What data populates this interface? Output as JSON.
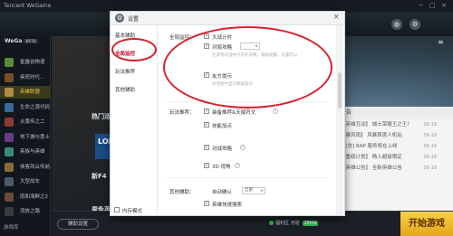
{
  "app": {
    "title": "Tencent WeGame",
    "brand": "WeGa",
    "brand_badge": "BETA",
    "nav_icons": [
      "home-icon",
      "shield-icon",
      "store-icon"
    ],
    "window_controls": [
      "−",
      "□",
      "×"
    ]
  },
  "sidebar": {
    "items": [
      {
        "label": "星露谷物语",
        "color": "#5c8a3a"
      },
      {
        "label": "疾死时代…",
        "color": "#7a4b2a"
      },
      {
        "label": "英雄联盟",
        "color": "#b08a43",
        "active": true
      },
      {
        "label": "生命之源代码",
        "color": "#3b6a9a"
      },
      {
        "label": "炎黄传之二",
        "color": "#8a3a3a"
      },
      {
        "label": "地下城与勇士",
        "color": "#6a3a8a"
      },
      {
        "label": "英族与英雄",
        "color": "#3a8a7a"
      },
      {
        "label": "侠客风云传前…",
        "color": "#8a6a3a"
      },
      {
        "label": "大型战车",
        "color": "#4a5a6a"
      },
      {
        "label": "雨和海鲜之2",
        "color": "#6a4a3a"
      },
      {
        "label": "流放之路",
        "color": "#3a3a3a"
      }
    ],
    "footer": "游戏库"
  },
  "hero": {
    "section_hot": "热门活",
    "promo_text": "LOL7",
    "section_new": "新F4",
    "section_cover": "周免英",
    "news_tab": "公告",
    "news": [
      {
        "title": "【英雄互动】 城士荣耀王之王！",
        "date": "09-16"
      },
      {
        "title": "【暴风雨】 风暴首席人机站",
        "date": "09-16"
      },
      {
        "title": "[公告] RAP 服务将在上线",
        "date": "09-16"
      },
      {
        "title": "【重磅计划】 杨入超级限定",
        "date": "09-16"
      },
      {
        "title": "【英雄公告】 全新英雄公告",
        "date": "09-16"
      }
    ]
  },
  "bottombar": {
    "settings_label": "辅助设置",
    "server_label": "福利区 河道",
    "ping": "28ms",
    "start_label": "开始游戏"
  },
  "dialog": {
    "title": "设置",
    "nav": [
      {
        "label": "基本辅助"
      },
      {
        "label": "全局监控",
        "active": true
      },
      {
        "label": "玩法推荐"
      },
      {
        "label": "其他辅助"
      }
    ],
    "groups": {
      "global": {
        "label": "全局监控：",
        "options": [
          {
            "label": "大战计时",
            "checked": true
          },
          {
            "label": "对局攻略",
            "checked": true,
            "select_value": "",
            "hint": "在游戏对战中打开此攻略，辅助提醒，设置可以"
          },
          {
            "label": "友方提示",
            "checked": true,
            "hint": "对话框中显示数据提示"
          }
        ]
      },
      "play": {
        "label": "玩法推荐：",
        "options": [
          {
            "label": "装备推荐&天赋符文",
            "checked": true
          },
          {
            "label": "技能加点",
            "checked": true
          },
          {
            "label": "对战攻略",
            "checked": true
          },
          {
            "label": "3D 视角",
            "checked": true
          }
        ]
      },
      "other": {
        "label": "其他辅助：",
        "select_label": "自动确认",
        "select_value": "全部",
        "options": [
          {
            "label": "英雄快速搜索",
            "checked": true
          }
        ]
      }
    },
    "footer_label": "内存模式"
  },
  "colors": {
    "accent_red": "#c8102e",
    "annotation": "#d6222b",
    "start_gold": "#f2c230"
  }
}
